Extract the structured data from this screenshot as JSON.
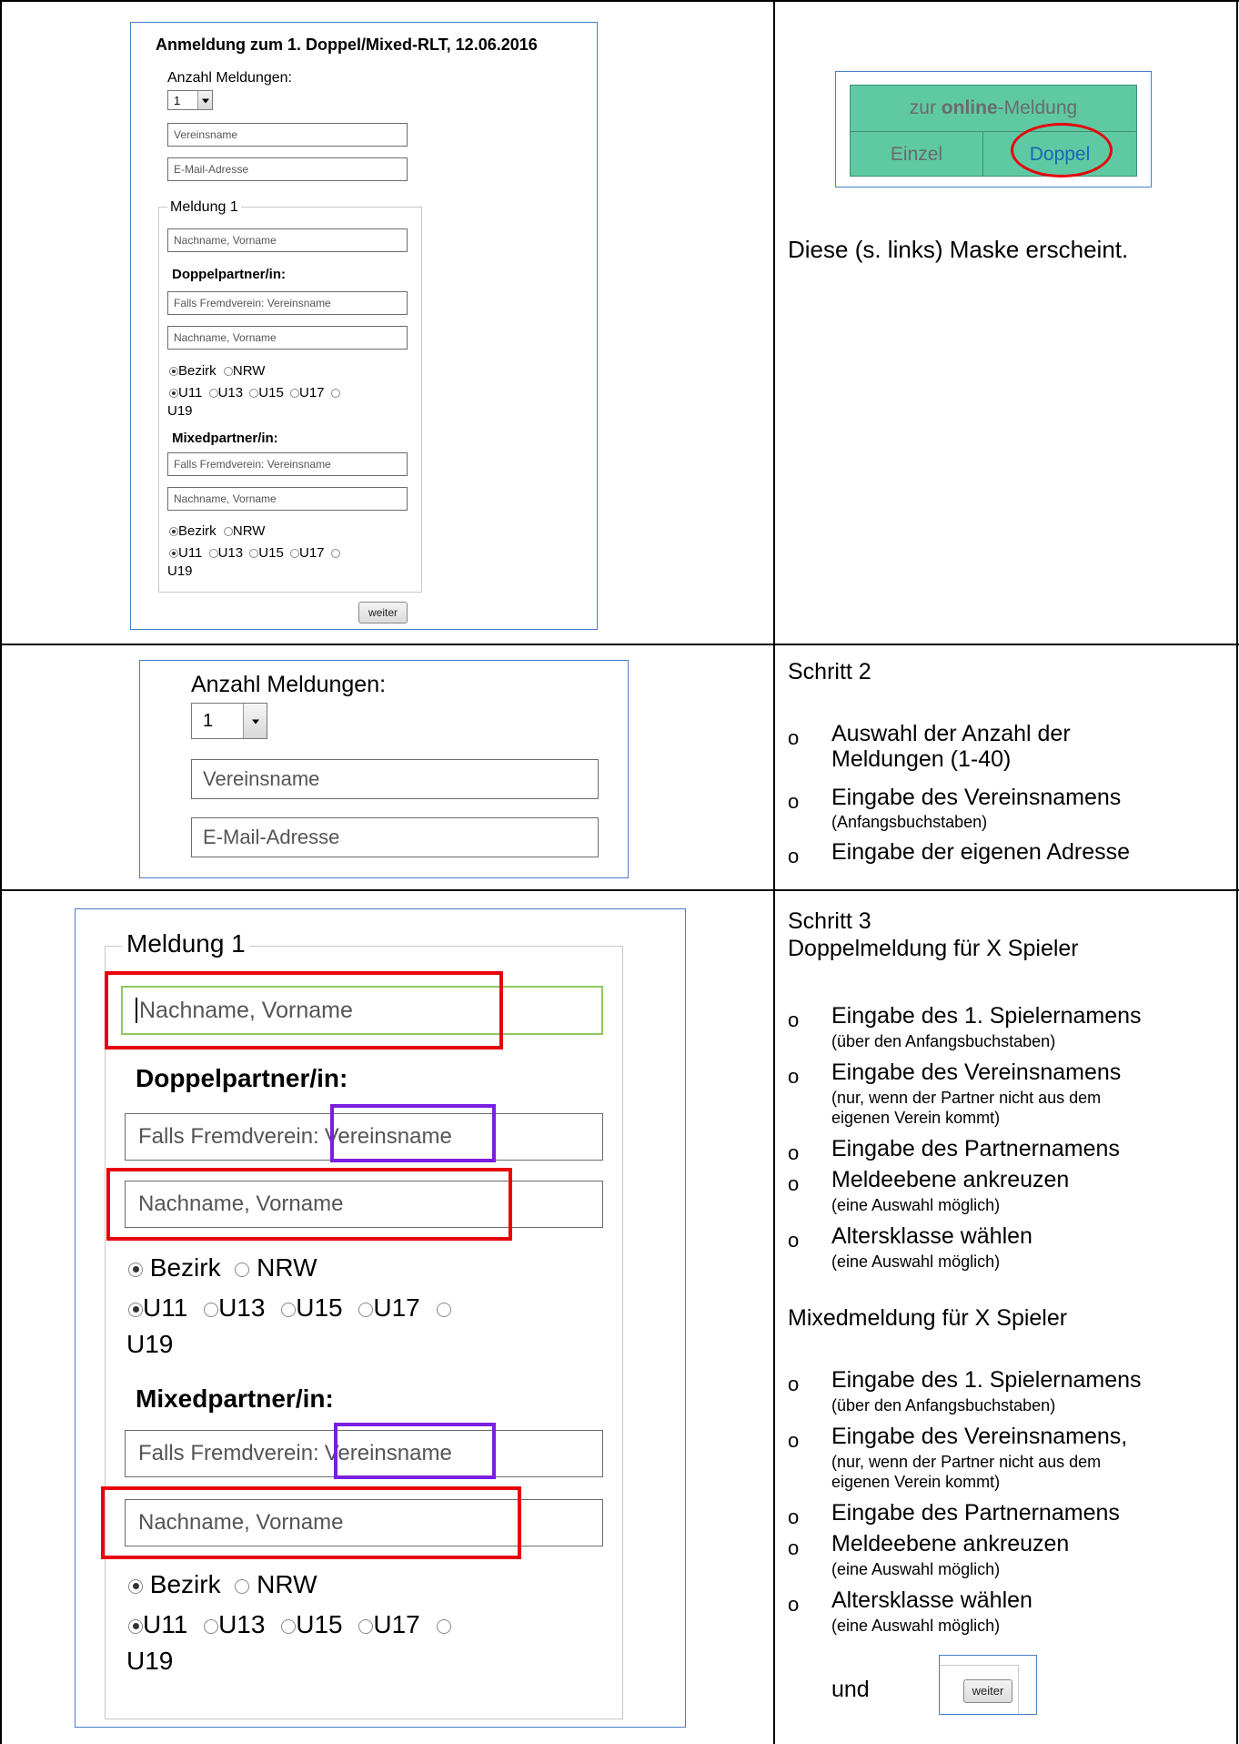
{
  "row1": {
    "form": {
      "title": "Anmeldung zum 1. Doppel/Mixed-RLT, 12.06.2016",
      "count_label": "Anzahl Meldungen:",
      "count_value": "1",
      "club_placeholder": "Vereinsname",
      "email_placeholder": "E-Mail-Adresse",
      "legend": "Meldung 1",
      "name_placeholder": "Nachname, Vorname",
      "doubles_label": "Doppelpartner/in:",
      "club_other_placeholder": "Falls Fremdverein: Vereinsname",
      "partner_placeholder": "Nachname, Vorname",
      "level_options": [
        "Bezirk",
        "NRW"
      ],
      "age_options": [
        "U11",
        "U13",
        "U15",
        "U17",
        "U19"
      ],
      "mixed_label": "Mixedpartner/in:",
      "mixed_club_placeholder": "Falls Fremdverein: Vereinsname",
      "mixed_partner_placeholder": "Nachname, Vorname",
      "next_button": "weiter"
    },
    "online": {
      "header_prefix": "zur ",
      "header_bold": "online",
      "header_suffix": "-Meldung",
      "single": "Einzel",
      "double": "Doppel"
    },
    "description": "Diese (s. links) Maske erscheint."
  },
  "row2": {
    "count_label": "Anzahl Meldungen:",
    "count_value": "1",
    "club_placeholder": "Vereinsname",
    "email_placeholder": "E-Mail-Adresse",
    "step": "Schritt 2",
    "bullets": [
      {
        "main": "Auswahl der Anzahl der",
        "cont": "Meldungen (1-40)",
        "note": ""
      },
      {
        "main": "Eingabe des Vereinsnamens",
        "cont": "",
        "note": "(Anfangsbuchstaben)"
      },
      {
        "main": "Eingabe der eigenen Adresse",
        "cont": "",
        "note": ""
      }
    ]
  },
  "row3": {
    "form": {
      "legend": "Meldung 1",
      "name_placeholder": "Nachname, Vorname",
      "doubles_label": "Doppelpartner/in:",
      "club_other_prefix": "Falls Fremdverein:",
      "club_other_suffix": "Vereinsname",
      "partner_placeholder": "Nachname, Vorname",
      "level_options": [
        "Bezirk",
        "NRW"
      ],
      "age_options": [
        "U11",
        "U13",
        "U15",
        "U17",
        "U19"
      ],
      "mixed_label": "Mixedpartner/in:",
      "mixed_club_prefix": "Falls Fremdverein:",
      "mixed_club_suffix": "Vereinsname",
      "mixed_partner_placeholder": "Nachname, Vorname"
    },
    "step": "Schritt 3",
    "doubles_heading": "Doppelmeldung für X Spieler",
    "doubles_bullets": [
      {
        "main": "Eingabe des 1. Spielernamens",
        "note": "(über den Anfangsbuchstaben)"
      },
      {
        "main": "Eingabe des Vereinsnamens",
        "note": "(nur, wenn der Partner nicht aus dem",
        "note2": "eigenen Verein kommt)"
      },
      {
        "main": "Eingabe des Partnernamens",
        "note": ""
      },
      {
        "main": "Meldeebene ankreuzen",
        "note": "(eine Auswahl möglich)"
      },
      {
        "main": "Altersklasse wählen",
        "note": "(eine Auswahl möglich)"
      }
    ],
    "mixed_heading": "Mixedmeldung für X Spieler",
    "mixed_bullets": [
      {
        "main": "Eingabe des 1. Spielernamens",
        "note": "(über den Anfangsbuchstaben)"
      },
      {
        "main": "Eingabe des Vereinsnamens,",
        "note": "(nur, wenn der Partner nicht aus dem",
        "note2": "eigenen Verein kommt)"
      },
      {
        "main": "Eingabe des Partnernamens",
        "note": ""
      },
      {
        "main": "Meldeebene ankreuzen",
        "note": "(eine Auswahl möglich)"
      },
      {
        "main": "Altersklasse wählen",
        "note": "(eine Auswahl möglich)"
      }
    ],
    "and_word": "und",
    "next_button": "weiter",
    "bullet_char": "o"
  }
}
